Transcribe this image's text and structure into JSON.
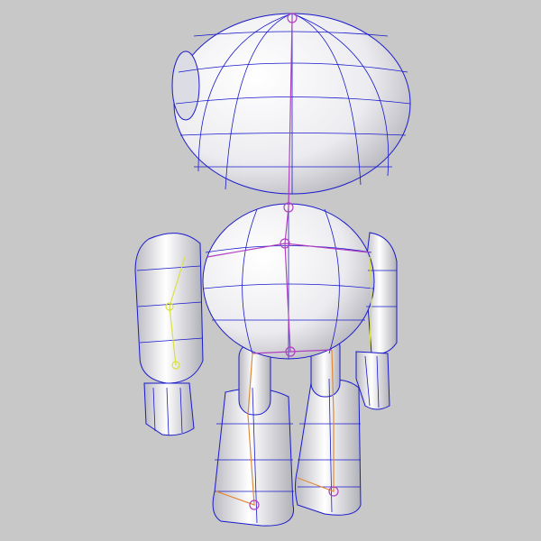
{
  "viewport": {
    "background": "#c8c8c8"
  },
  "colors": {
    "wireframe": "#1a1acc",
    "skeleton_spine": "#b040c0",
    "skeleton_limb": "#e08a3a",
    "skeleton_arm_highlight": "#d8e040",
    "surface_light": "#ffffff",
    "surface_shadow": "#a8a8b0"
  }
}
